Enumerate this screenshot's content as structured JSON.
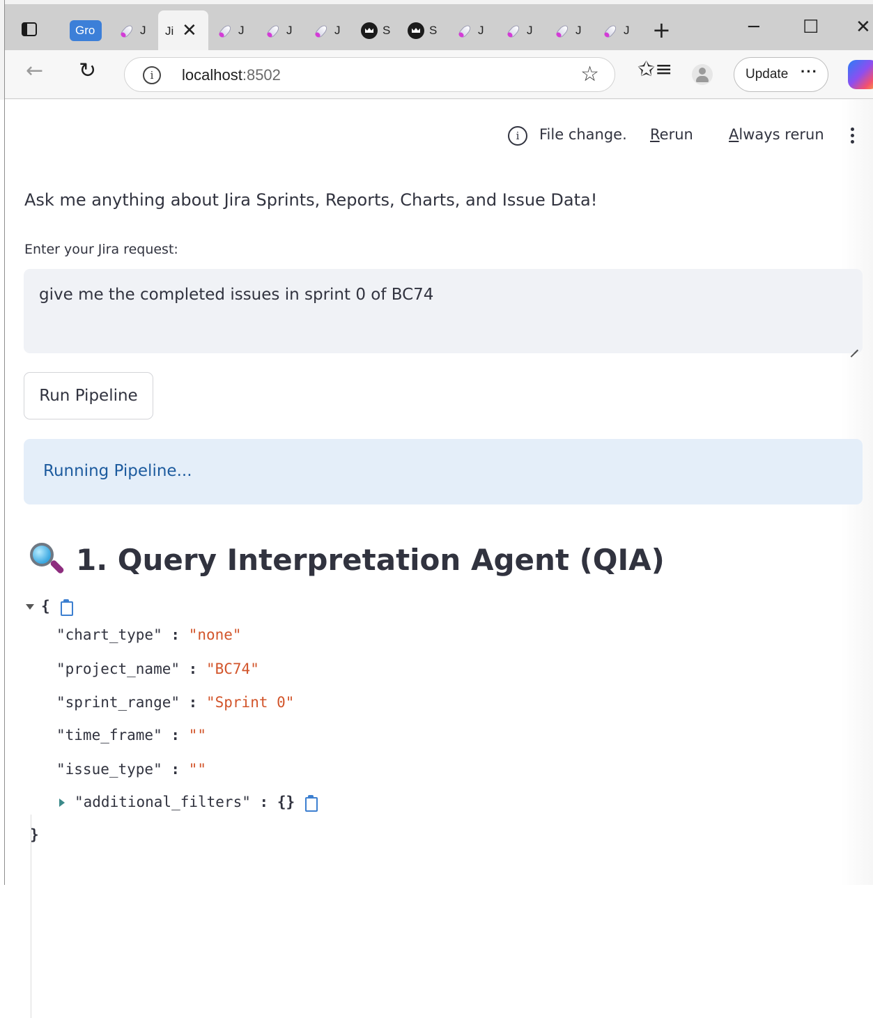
{
  "browser": {
    "tabs": [
      {
        "label": "Gro",
        "kind": "group"
      },
      {
        "label": "J",
        "kind": "rocket"
      },
      {
        "label": "Ji",
        "kind": "active"
      },
      {
        "label": "J",
        "kind": "rocket"
      },
      {
        "label": "J",
        "kind": "rocket"
      },
      {
        "label": "J",
        "kind": "rocket"
      },
      {
        "label": "S",
        "kind": "crown"
      },
      {
        "label": "S",
        "kind": "crown"
      },
      {
        "label": "J",
        "kind": "rocket"
      },
      {
        "label": "J",
        "kind": "rocket"
      },
      {
        "label": "J",
        "kind": "rocket"
      },
      {
        "label": "J",
        "kind": "rocket"
      }
    ],
    "close_glyph": "✕",
    "new_tab_glyph": "+",
    "window": {
      "minimize": "─",
      "maximize": "☐",
      "close": "✕"
    },
    "address": {
      "host": "localhost",
      "port": ":8502"
    },
    "update_label": "Update",
    "more_glyph": "···"
  },
  "app": {
    "status": {
      "message": "File change.",
      "rerun": "Rerun",
      "always_rerun": "Always rerun"
    },
    "intro": "Ask me anything about Jira Sprints, Reports, Charts, and Issue Data!",
    "input_label": "Enter your Jira request:",
    "input_value": "give me the completed issues in sprint 0 of BC74",
    "run_button": "Run Pipeline",
    "alert": "Running Pipeline...",
    "section_title": "1. Query Interpretation Agent (QIA)",
    "json": {
      "open": "{",
      "close": "}",
      "fields": [
        {
          "key": "\"chart_type\"",
          "value": "\"none\""
        },
        {
          "key": "\"project_name\"",
          "value": "\"BC74\""
        },
        {
          "key": "\"sprint_range\"",
          "value": "\"Sprint 0\""
        },
        {
          "key": "\"time_frame\"",
          "value": "\"\""
        },
        {
          "key": "\"issue_type\"",
          "value": "\"\""
        }
      ],
      "collapsed_key": "\"additional_filters\"",
      "collapsed_value": "{}",
      "separator": ":"
    }
  },
  "colors": {
    "accent_blue": "#1d5b9e",
    "alert_bg": "#e4eef9",
    "string_value": "#d2552b"
  }
}
